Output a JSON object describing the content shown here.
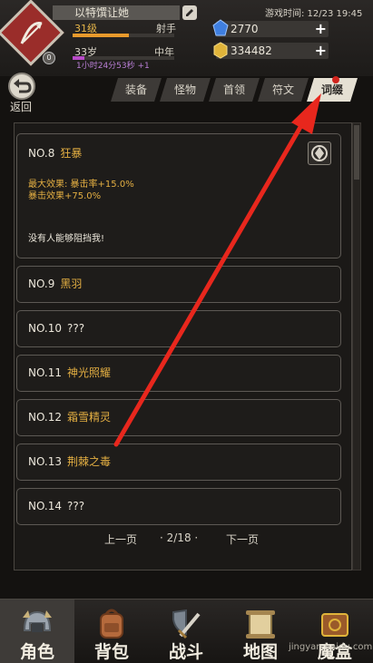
{
  "header": {
    "player_name": "以特馔让她",
    "avatar_level": "0",
    "level": "31级",
    "class": "射手",
    "xp_progress": 0.55,
    "age": "33岁",
    "life_stage": "中年",
    "age_progress": 0.12,
    "time_remaining": "1小时24分53秒 +1",
    "game_time": "游戏时间: 12/23 19:45",
    "gems": "2770",
    "gold": "334482",
    "gem_color": "#3f7fe0",
    "gold_color": "#e0b43a"
  },
  "back": {
    "label": "返回"
  },
  "tabs": [
    {
      "label": "装备"
    },
    {
      "label": "怪物"
    },
    {
      "label": "首领"
    },
    {
      "label": "符文"
    },
    {
      "label": "词缀",
      "active": true
    }
  ],
  "detail": {
    "no": "NO.8",
    "name": "狂暴",
    "effect_max": "最大效果: 暴击率+15.0%",
    "effect_crit": "暴击效果+75.0%",
    "quote": "没有人能够阻挡我!"
  },
  "entries": [
    {
      "no": "NO.9",
      "name": "黑羽"
    },
    {
      "no": "NO.10",
      "name": "???"
    },
    {
      "no": "NO.11",
      "name": "神光照耀"
    },
    {
      "no": "NO.12",
      "name": "霜雪精灵"
    },
    {
      "no": "NO.13",
      "name": "荆棘之毒"
    },
    {
      "no": "NO.14",
      "name": "???"
    }
  ],
  "pager": {
    "prev": "上一页",
    "page": "· 2/18 ·",
    "next": "下一页"
  },
  "nav": [
    {
      "label": "角色",
      "icon": "helmet-icon"
    },
    {
      "label": "背包",
      "icon": "backpack-icon"
    },
    {
      "label": "战斗",
      "icon": "sword-shield-icon"
    },
    {
      "label": "地图",
      "icon": "scroll-map-icon"
    },
    {
      "label": "魔盒",
      "icon": "magic-box-icon"
    }
  ],
  "watermark": "jingyan.baidu.com",
  "annotation_color": "#e8271d"
}
